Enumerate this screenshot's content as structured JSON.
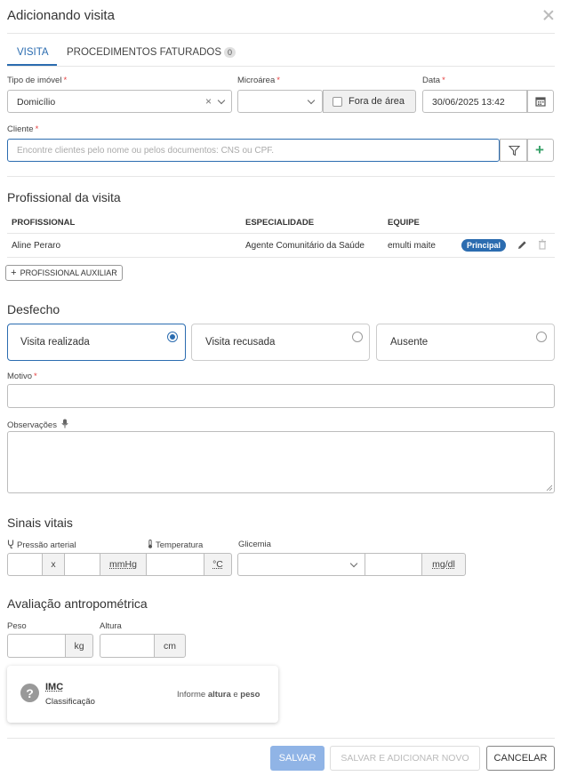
{
  "dialog": {
    "title": "Adicionando visita"
  },
  "tabs": [
    {
      "label": "VISITA"
    },
    {
      "label": "PROCEDIMENTOS FATURADOS",
      "count": "0"
    }
  ],
  "form": {
    "tipo_imovel": {
      "label": "Tipo de imóvel",
      "value": "Domicílio"
    },
    "microarea": {
      "label": "Microárea",
      "value": ""
    },
    "fora_area": {
      "label": "Fora de área"
    },
    "data": {
      "label": "Data",
      "value": "30/06/2025 13:42"
    },
    "cliente": {
      "label": "Cliente",
      "placeholder": "Encontre clientes pelo nome ou pelos documentos: CNS ou CPF."
    }
  },
  "profissional": {
    "section_title": "Profissional da visita",
    "headers": [
      "PROFISSIONAL",
      "ESPECIALIDADE",
      "EQUIPE"
    ],
    "rows": [
      {
        "nome": "Aline Peraro",
        "especialidade": "Agente Comunitário da Saúde",
        "equipe": "emulti maite",
        "badge": "Principal"
      }
    ],
    "add_button": "PROFISSIONAL AUXILIAR"
  },
  "desfecho": {
    "section_title": "Desfecho",
    "options": [
      "Visita realizada",
      "Visita recusada",
      "Ausente"
    ],
    "selected": 0,
    "motivo_label": "Motivo",
    "observacoes_label": "Observações"
  },
  "sinais": {
    "section_title": "Sinais vitais",
    "pressao_label": "Pressão arterial",
    "pressao_sep": "x",
    "pressao_unit": "mmHg",
    "temperatura_label": "Temperatura",
    "temperatura_unit": "°C",
    "glicemia_label": "Glicemia",
    "glicemia_unit": "mg/dl"
  },
  "antropometria": {
    "section_title": "Avaliação antropométrica",
    "peso_label": "Peso",
    "peso_unit": "kg",
    "altura_label": "Altura",
    "altura_unit": "cm",
    "imc_title": "IMC",
    "imc_sub": "Classificação",
    "imc_hint_prefix": "Informe ",
    "imc_hint_altura": "altura",
    "imc_hint_and": " e ",
    "imc_hint_peso": "peso"
  },
  "footer": {
    "salvar": "SALVAR",
    "salvar_novo": "SALVAR E ADICIONAR NOVO",
    "cancelar": "CANCELAR"
  },
  "colors": {
    "accent": "#2b6cb0",
    "required": "#e53e3e",
    "add_green": "#38a169",
    "save_disabled": "#90b4e6"
  }
}
